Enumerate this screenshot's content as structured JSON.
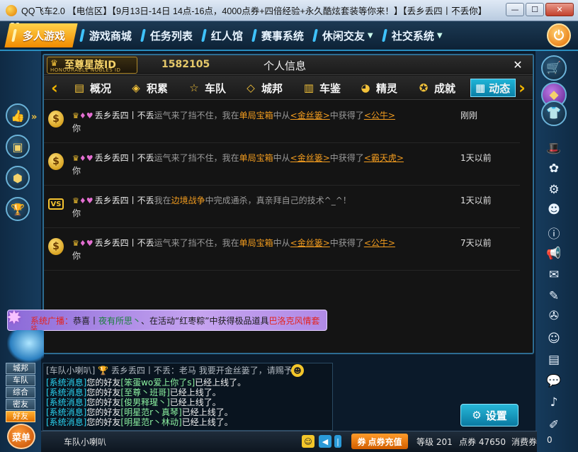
{
  "window": {
    "title": "QQ飞车2.0 【电信区】【9月13日-14日 14点-16点，4000点券+四倍经验+永久酷炫套装等你来！】【丢乡丢四丨不丢你】",
    "min": "0",
    "max": "1",
    "close": "r"
  },
  "topnav": {
    "corner": "31",
    "tabs": [
      {
        "label": "多人游戏"
      },
      {
        "label": "游戏商城"
      },
      {
        "label": "任务列表"
      },
      {
        "label": "红人馆"
      },
      {
        "label": "赛事系统"
      },
      {
        "label": "休闲交友"
      },
      {
        "label": "社交系统"
      }
    ]
  },
  "panel": {
    "vip_title": "至尊星族ID",
    "vip_sub": "HONOURABLE NOBLES ID",
    "player_id": "1582105",
    "title": "个人信息",
    "tabs": [
      {
        "label": "概况",
        "icon": "id-card-icon"
      },
      {
        "label": "积累",
        "icon": "stack-icon"
      },
      {
        "label": "车队",
        "icon": "star-icon"
      },
      {
        "label": "城邦",
        "icon": "layers-icon"
      },
      {
        "label": "车鉴",
        "icon": "book-icon"
      },
      {
        "label": "精灵",
        "icon": "sprite-icon"
      },
      {
        "label": "成就",
        "icon": "medal-icon"
      },
      {
        "label": "动态",
        "icon": "calendar-icon"
      }
    ]
  },
  "feed": [
    {
      "icon": "coin",
      "icon_text": "$",
      "name": "丢乡丢四丨不丢",
      "action1": "运气来了挡不住，我在",
      "location": "单局宝箱",
      "action2": "中从",
      "source": "<金丝篓>",
      "action3": "中获得了",
      "item": "<公牛>",
      "second_line": "你",
      "time": "刚刚"
    },
    {
      "icon": "coin",
      "icon_text": "$",
      "name": "丢乡丢四丨不丢",
      "action1": "运气来了挡不住，我在",
      "location": "单局宝箱",
      "action2": "中从",
      "source": "<金丝篓>",
      "action3": "中获得了",
      "item": "<霸天虎>",
      "second_line": "你",
      "time": "1天以前"
    },
    {
      "icon": "vs",
      "icon_text": "VS",
      "name": "丢乡丢四丨不丢",
      "action1": "我在",
      "location": "边境战争",
      "action2": "中完成通杀，真亲拜自己的技术^_^！",
      "source": "",
      "action3": "",
      "item": "",
      "second_line": "你",
      "time": "1天以前"
    },
    {
      "icon": "coin",
      "icon_text": "$",
      "name": "丢乡丢四丨不丢",
      "action1": "运气来了挡不住，我在",
      "location": "单局宝箱",
      "action2": "中从",
      "source": "<金丝篓>",
      "action3": "中获得了",
      "item": "<公牛>",
      "second_line": "你",
      "time": "7天以前"
    }
  ],
  "broadcast": {
    "label": "系统广播：",
    "text1": "恭喜丨",
    "player": "夜有所思丶",
    "text2": "、在活动“红枣粽”中获得极品道具",
    "prize": "巴洛克风情套",
    "tail": "装"
  },
  "chat": {
    "top": "[车队小喇叭] 🏆 丢乡丢四丨不丢：老马 我要开金丝篓了，请赐予我力量",
    "messages": [
      {
        "sys": "[系统消息]",
        "mid": "您的好友",
        "name": "[笨蛋wo爱上你了s]",
        "tail": "已经上线了。"
      },
      {
        "sys": "[系统消息]",
        "mid": "您的好友",
        "name": "[至尊丶班哥]",
        "tail": "已经上线了。"
      },
      {
        "sys": "[系统消息]",
        "mid": "您的好友",
        "name": "[俊男释瑆丶]",
        "tail": "已经上线了。"
      },
      {
        "sys": "[系统消息]",
        "mid": "您的好友",
        "name": "[明星范r丶真琴]",
        "tail": "已经上线了。"
      },
      {
        "sys": "[系统消息]",
        "mid": "您的好友",
        "name": "[明星范r丶林动]",
        "tail": "已经上线了。"
      }
    ]
  },
  "left_tabs": [
    "城邦",
    "车队",
    "综合",
    "密友",
    "好友"
  ],
  "menu_label": "菜单",
  "settings_label": "设置",
  "status": {
    "channel": "车队小喇叭",
    "recharge": "点券充值",
    "level_label": "等级",
    "level": "201",
    "points_label": "点券",
    "points": "47650",
    "coupon_label": "消费券",
    "coupon": "0"
  },
  "colors": {
    "accent": "#1fb5d8",
    "highlight": "#f29c1f",
    "system_msg": "#2ad3f0",
    "friend_name": "#8bf0a0"
  }
}
